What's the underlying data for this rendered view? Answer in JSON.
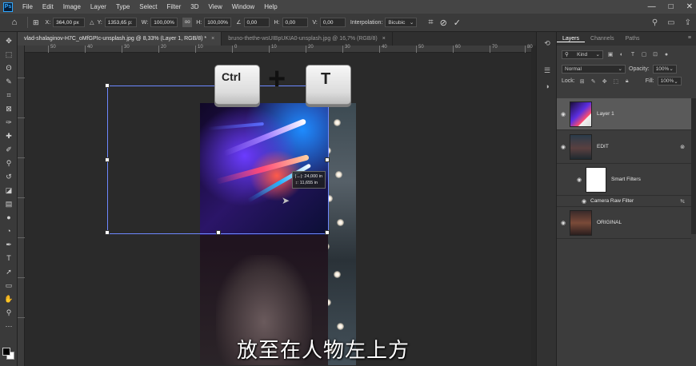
{
  "app": {
    "logo": "Ps"
  },
  "menu": [
    "File",
    "Edit",
    "Image",
    "Layer",
    "Type",
    "Select",
    "Filter",
    "3D",
    "View",
    "Window",
    "Help"
  ],
  "window_controls": {
    "minimize": "—",
    "maximize": "□",
    "close": "✕"
  },
  "options_bar": {
    "x_label": "X:",
    "x_value": "364,00 px",
    "y_label": "Y:",
    "y_value": "1353,65 p:",
    "w_label": "W:",
    "w_value": "100,00%",
    "link_label": "oo",
    "h_label": "H:",
    "h_value": "100,00%",
    "angle_value": "0,00",
    "hskew_label": "H:",
    "hskew_value": "0,00",
    "vskew_label": "V:",
    "vskew_value": "0,00",
    "interp_label": "Interpolation:",
    "interp_value": "Bicubic",
    "cancel_icon": "⊘",
    "commit_icon": "✓"
  },
  "tabs": [
    {
      "label": "vlad-shalaginov-H7C_oMfGPIc-unsplash.jpg @ 8,33% (Layer 1, RGB/8) *",
      "close": "×"
    },
    {
      "label": "bruno-thethe-wsUIBpUKIA0-unsplash.jpg @ 16,7% (RGB/8)",
      "close": "×"
    }
  ],
  "ruler_labels": [
    "50",
    "40",
    "30",
    "20",
    "10",
    "0",
    "10",
    "20",
    "30",
    "40",
    "50",
    "60",
    "70",
    "80"
  ],
  "keycaps": {
    "ctrl": "Ctrl",
    "plus": "+",
    "t": "T"
  },
  "readout": {
    "w": "|↔|: 24,000 in",
    "h": "↕: 11,655 in"
  },
  "subtitle": "放至在人物左上方",
  "panel": {
    "tabs": [
      "Layers",
      "Channels",
      "Paths"
    ],
    "menu_icon": "≡",
    "filter_kind": "Kind",
    "blend_mode": "Normal",
    "opacity_label": "Opacity:",
    "opacity_value": "100%",
    "lock_label": "Lock:",
    "fill_label": "Fill:",
    "fill_value": "100%",
    "layers": [
      {
        "name": "Layer 1"
      },
      {
        "name": "EDIT"
      },
      {
        "name": "Smart Filters"
      },
      {
        "name": "Camera Raw Filter"
      },
      {
        "name": "ORIGINAL"
      }
    ]
  },
  "colors": {
    "accent": "#6d88ff",
    "menu_bg": "#454545",
    "canvas_bg": "#2a2a2a",
    "panel_bg": "#3c3c3c"
  }
}
